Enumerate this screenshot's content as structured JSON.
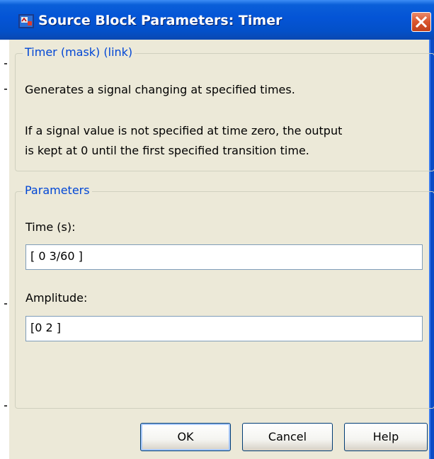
{
  "window": {
    "title": "Source Block Parameters: Timer"
  },
  "icons": {
    "app_icon": "simulink-block-icon",
    "close_icon": "close-icon"
  },
  "description_group": {
    "legend": "Timer (mask) (link)",
    "lines": [
      "Generates a signal changing at specified times.",
      "If a signal value is not specified at time zero, the output",
      "is kept at 0 until the first specified transition time."
    ]
  },
  "parameters_group": {
    "legend": "Parameters",
    "time": {
      "label": "Time (s):",
      "value": "[ 0  3/60 ]"
    },
    "amplitude": {
      "label": "Amplitude:",
      "value": "[0  2 ]"
    }
  },
  "buttons": {
    "ok": "OK",
    "cancel": "Cancel",
    "help": "Help"
  },
  "colors": {
    "titlebar": "#0454d6",
    "legend_text": "#0046d5",
    "window_bg": "#ece9d8",
    "close_button": "#d9542c"
  }
}
